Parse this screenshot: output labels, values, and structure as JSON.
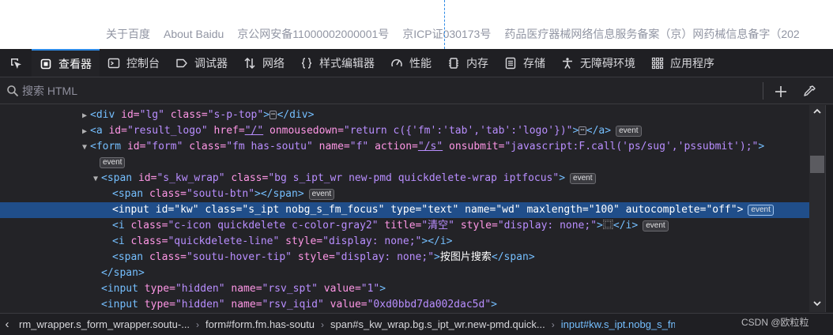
{
  "page": {
    "footer_links": [
      "关于百度",
      "About Baidu",
      "京公网安备11000002000001号",
      "京ICP证030173号",
      "药品医疗器械网络信息服务备案（京）网药械信息备字（202"
    ]
  },
  "toolbar": {
    "tabs": [
      {
        "label": "查看器",
        "icon": "inspector-icon",
        "active": true
      },
      {
        "label": "控制台",
        "icon": "console-icon"
      },
      {
        "label": "调试器",
        "icon": "debugger-icon"
      },
      {
        "label": "网络",
        "icon": "network-icon"
      },
      {
        "label": "样式编辑器",
        "icon": "style-editor-icon"
      },
      {
        "label": "性能",
        "icon": "performance-icon"
      },
      {
        "label": "内存",
        "icon": "memory-icon"
      },
      {
        "label": "存储",
        "icon": "storage-icon"
      },
      {
        "label": "无障碍环境",
        "icon": "accessibility-icon"
      },
      {
        "label": "应用程序",
        "icon": "application-icon"
      }
    ],
    "picker_icon": "element-picker-icon"
  },
  "search": {
    "placeholder": "搜索 HTML"
  },
  "tree": {
    "badge": "event",
    "lines": [
      {
        "indent": 0,
        "tw": "▶",
        "parts": [
          [
            "tag",
            "<div "
          ],
          [
            "an",
            "id="
          ],
          [
            "av",
            "\"lg\""
          ],
          [
            "an",
            " class="
          ],
          [
            "av",
            "\"s-p-top\""
          ],
          [
            "tag",
            ">"
          ],
          [
            "ell",
            "⋯"
          ],
          [
            "tag",
            "</div>"
          ]
        ]
      },
      {
        "indent": 0,
        "tw": "▶",
        "parts": [
          [
            "tag",
            "<a "
          ],
          [
            "an",
            "id="
          ],
          [
            "av",
            "\"result_logo\""
          ],
          [
            "an",
            " href="
          ],
          [
            "av",
            "\"/\""
          ],
          [
            "an",
            " onmousedown="
          ],
          [
            "av",
            "\"return c({'fm':'tab','tab':'logo'})\""
          ],
          [
            "tag",
            ">"
          ],
          [
            "ell",
            "⋯"
          ],
          [
            "tag",
            "</a>"
          ]
        ],
        "badge": true
      },
      {
        "indent": 0,
        "tw": "▼",
        "parts": [
          [
            "tag",
            "<form "
          ],
          [
            "an",
            "id="
          ],
          [
            "av",
            "\"form\""
          ],
          [
            "an",
            " class="
          ],
          [
            "av",
            "\"fm has-soutu\""
          ],
          [
            "an",
            " name="
          ],
          [
            "av",
            "\"f\""
          ],
          [
            "an",
            " action="
          ],
          [
            "av",
            "\"/s\""
          ],
          [
            "an",
            " onsubmit="
          ],
          [
            "av",
            "\"javascript:F.call('ps/sug','pssubmit');\""
          ],
          [
            "tag",
            ">"
          ]
        ]
      },
      {
        "indent": 0,
        "tw": "",
        "parts": [],
        "badge": true
      },
      {
        "indent": 1,
        "tw": "▼",
        "parts": [
          [
            "tag",
            "<span "
          ],
          [
            "an",
            "id="
          ],
          [
            "av",
            "\"s_kw_wrap\""
          ],
          [
            "an",
            " class="
          ],
          [
            "av",
            "\"bg s_ipt_wr new-pmd quickdelete-wrap iptfocus\""
          ],
          [
            "tag",
            ">"
          ]
        ],
        "badge": true
      },
      {
        "indent": 2,
        "tw": "",
        "parts": [
          [
            "tag",
            "<span "
          ],
          [
            "an",
            "class="
          ],
          [
            "av",
            "\"soutu-btn\""
          ],
          [
            "tag",
            "></span>"
          ]
        ],
        "badge": true
      },
      {
        "indent": 2,
        "tw": "",
        "selected": true,
        "parts": [
          [
            "tag",
            "<input "
          ],
          [
            "an",
            "id="
          ],
          [
            "av",
            "\"kw\""
          ],
          [
            "an",
            " class="
          ],
          [
            "av",
            "\"s_ipt nobg_s_fm_focus\""
          ],
          [
            "an",
            " type="
          ],
          [
            "av",
            "\"text\""
          ],
          [
            "an",
            " name="
          ],
          [
            "av",
            "\"wd\""
          ],
          [
            "an",
            " maxlength="
          ],
          [
            "av",
            "\"100\""
          ],
          [
            "an",
            " autocomplete="
          ],
          [
            "av",
            "\"off\""
          ],
          [
            "tag",
            ">"
          ]
        ],
        "badge": true
      },
      {
        "indent": 2,
        "tw": "",
        "parts": [
          [
            "tag",
            "<i "
          ],
          [
            "an",
            "class="
          ],
          [
            "av",
            "\"c-icon quickdelete c-color-gray2\""
          ],
          [
            "an",
            " title="
          ],
          [
            "av",
            "\"清空\""
          ],
          [
            "an",
            " style="
          ],
          [
            "av",
            "\"display: none;\""
          ],
          [
            "tag",
            ">"
          ],
          [
            "tx",
            "⿴"
          ],
          [
            "tag",
            "</i>"
          ]
        ],
        "badge": true
      },
      {
        "indent": 2,
        "tw": "",
        "parts": [
          [
            "tag",
            "<i "
          ],
          [
            "an",
            "class="
          ],
          [
            "av",
            "\"quickdelete-line\""
          ],
          [
            "an",
            " style="
          ],
          [
            "av",
            "\"display: none;\""
          ],
          [
            "tag",
            "></i>"
          ]
        ]
      },
      {
        "indent": 2,
        "tw": "",
        "parts": [
          [
            "tag",
            "<span "
          ],
          [
            "an",
            "class="
          ],
          [
            "av",
            "\"soutu-hover-tip\""
          ],
          [
            "an",
            " style="
          ],
          [
            "av",
            "\"display: none;\""
          ],
          [
            "tag",
            ">"
          ],
          [
            "tx",
            "按图片搜索"
          ],
          [
            "tag",
            "</span>"
          ]
        ]
      },
      {
        "indent": 1,
        "tw": "",
        "parts": [
          [
            "tag",
            "</span>"
          ]
        ]
      },
      {
        "indent": 1,
        "tw": "",
        "parts": [
          [
            "tag",
            "<input "
          ],
          [
            "an",
            "type="
          ],
          [
            "av",
            "\"hidden\""
          ],
          [
            "an",
            " name="
          ],
          [
            "av",
            "\"rsv_spt\""
          ],
          [
            "an",
            " value="
          ],
          [
            "av",
            "\"1\""
          ],
          [
            "tag",
            ">"
          ]
        ]
      },
      {
        "indent": 1,
        "tw": "",
        "parts": [
          [
            "tag",
            "<input "
          ],
          [
            "an",
            "type="
          ],
          [
            "av",
            "\"hidden\""
          ],
          [
            "an",
            " name="
          ],
          [
            "av",
            "\"rsv_iqid\""
          ],
          [
            "an",
            " value="
          ],
          [
            "av",
            "\"0xd0bbd7da002dac5d\""
          ],
          [
            "tag",
            ">"
          ]
        ]
      }
    ]
  },
  "breadcrumbs": {
    "items": [
      "rm_wrapper.s_form_wrapper.soutu-...",
      "form#form.fm.has-soutu",
      "span#s_kw_wrap.bg.s_ipt_wr.new-pmd.quick...",
      "input#kw.s_ipt.nobg_s_fm_focus"
    ],
    "current_index": 3
  },
  "watermark": "CSDN @欧粒粒",
  "colors": {
    "accent": "#2f8be6",
    "selected_row": "#204e8a",
    "tag": "#75bfff",
    "attr_name": "#ff97e6",
    "attr_value": "#b98eff"
  }
}
